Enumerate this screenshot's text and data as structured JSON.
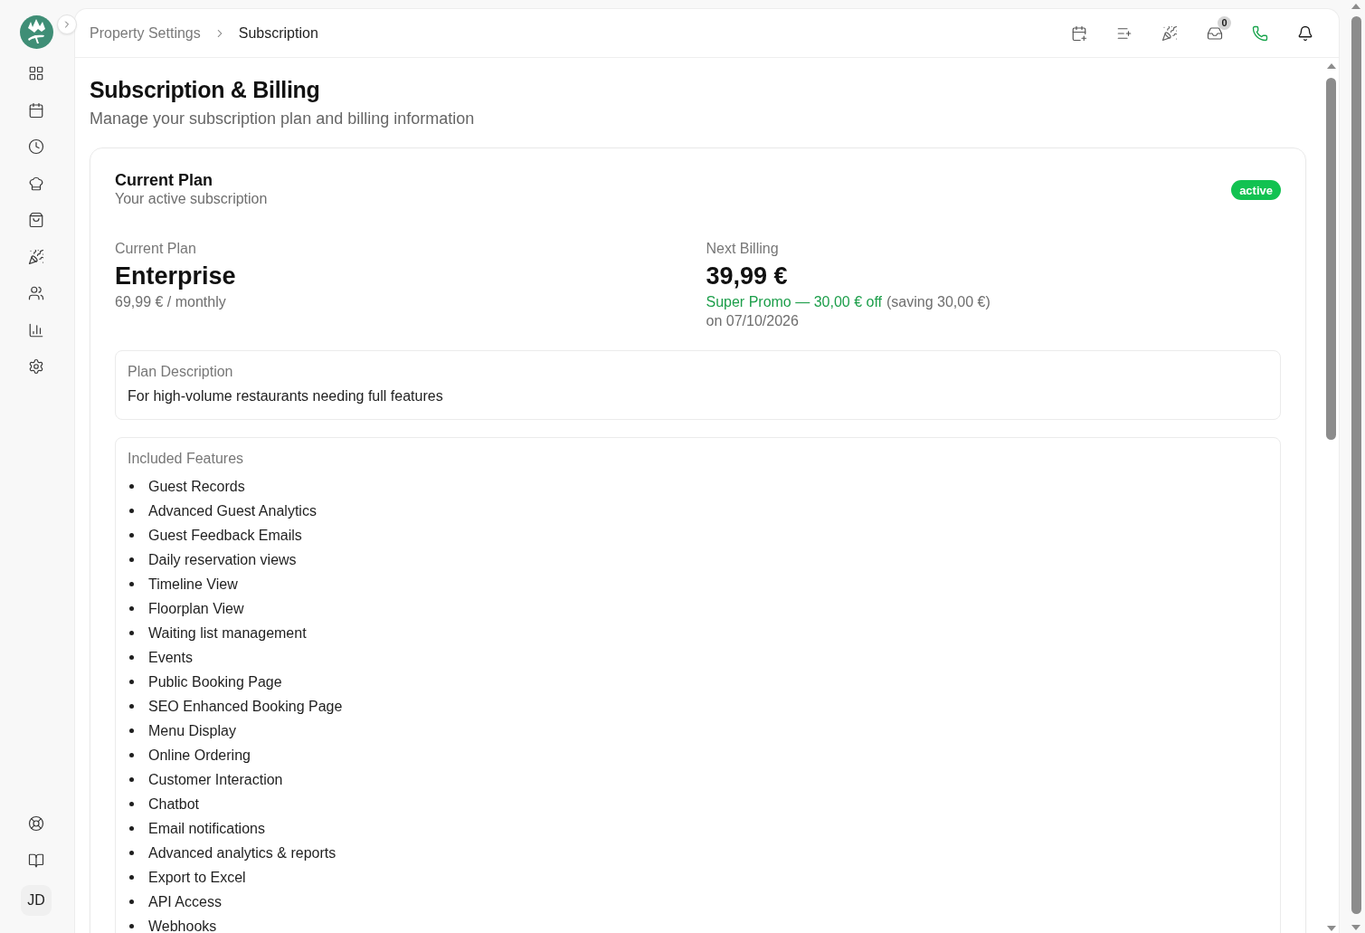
{
  "sidebar": {
    "avatar": "JD"
  },
  "header": {
    "breadcrumb": [
      {
        "label": "Property Settings",
        "current": false
      },
      {
        "label": "Subscription",
        "current": true
      }
    ],
    "inbox_count": "0"
  },
  "page": {
    "title": "Subscription & Billing",
    "subtitle": "Manage your subscription plan and billing information"
  },
  "plan_card": {
    "title": "Current Plan",
    "subtitle": "Your active subscription",
    "status": "active",
    "current_plan": {
      "label": "Current Plan",
      "name": "Enterprise",
      "price": "69,99 € / monthly"
    },
    "next_billing": {
      "label": "Next Billing",
      "amount": "39,99 €",
      "promo": "Super Promo — 30,00 € off",
      "saving": "(saving 30,00 €)",
      "date": "on 07/10/2026"
    },
    "description": {
      "label": "Plan Description",
      "text": "For high-volume restaurants needing full features"
    },
    "features": {
      "label": "Included Features",
      "items": [
        "Guest Records",
        "Advanced Guest Analytics",
        "Guest Feedback Emails",
        "Daily reservation views",
        "Timeline View",
        "Floorplan View",
        "Waiting list management",
        "Events",
        "Public Booking Page",
        "SEO Enhanced Booking Page",
        "Menu Display",
        "Online Ordering",
        "Customer Interaction",
        "Chatbot",
        "Email notifications",
        "Advanced analytics & reports",
        "Export to Excel",
        "API Access",
        "Webhooks"
      ]
    }
  }
}
